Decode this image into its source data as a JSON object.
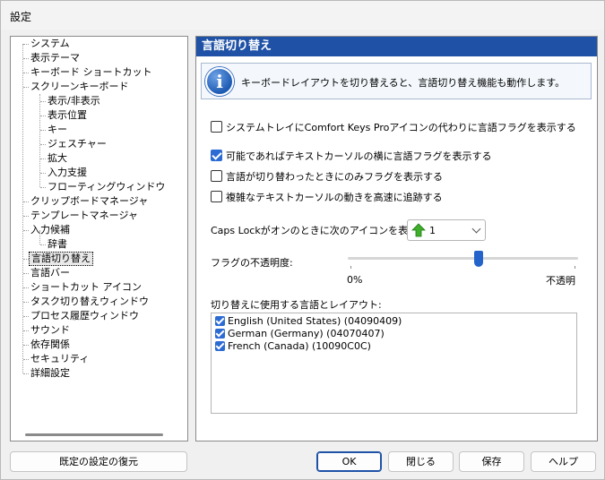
{
  "window": {
    "title": "設定"
  },
  "tree": {
    "items": [
      {
        "label": "システム"
      },
      {
        "label": "表示テーマ"
      },
      {
        "label": "キーボード ショートカット"
      },
      {
        "label": "スクリーンキーボード"
      },
      {
        "label": "表示/非表示"
      },
      {
        "label": "表示位置"
      },
      {
        "label": "キー"
      },
      {
        "label": "ジェスチャー"
      },
      {
        "label": "拡大"
      },
      {
        "label": "入力支援"
      },
      {
        "label": "フローティングウィンドウ"
      },
      {
        "label": "クリップボードマネージャ"
      },
      {
        "label": "テンプレートマネージャ"
      },
      {
        "label": "入力候補"
      },
      {
        "label": "辞書"
      },
      {
        "label": "言語切り替え"
      },
      {
        "label": "言語バー"
      },
      {
        "label": "ショートカット アイコン"
      },
      {
        "label": "タスク切り替えウィンドウ"
      },
      {
        "label": "プロセス履歴ウィンドウ"
      },
      {
        "label": "サウンド"
      },
      {
        "label": "依存関係"
      },
      {
        "label": "セキュリティ"
      },
      {
        "label": "詳細設定"
      }
    ],
    "selected": "言語切り替え"
  },
  "panel": {
    "title": "言語切り替え",
    "info": "キーボードレイアウトを切り替えると、言語切り替え機能も動作します。",
    "options": [
      {
        "label": "システムトレイにComfort Keys Proアイコンの代わりに言語フラグを表示する",
        "checked": false
      },
      {
        "label": "可能であればテキストカーソルの横に言語フラグを表示する",
        "checked": true
      },
      {
        "label": "言語が切り替わったときにのみフラグを表示する",
        "checked": false
      },
      {
        "label": "複雑なテキストカーソルの動きを高速に追跡する",
        "checked": false
      }
    ],
    "caps_lock_label": "Caps Lockがオンのときに次のアイコンを表示:",
    "caps_lock_value": "1",
    "opacity_label": "フラグの不透明度:",
    "opacity_min_label": "0%",
    "opacity_max_label": "不透明",
    "opacity_value": 0.57,
    "languages_label": "切り替えに使用する言語とレイアウト:",
    "languages": [
      {
        "label": "English (United States) (04090409)",
        "checked": true
      },
      {
        "label": "German (Germany) (04070407)",
        "checked": true
      },
      {
        "label": "French (Canada) (10090C0C)",
        "checked": true
      }
    ]
  },
  "buttons": {
    "restore": "既定の設定の復元",
    "ok": "OK",
    "close": "閉じる",
    "save": "保存",
    "help": "ヘルプ"
  },
  "colors": {
    "header": "#1f52a6",
    "accent": "#2c6bd4",
    "arrow_icon": "#3fae2a"
  }
}
